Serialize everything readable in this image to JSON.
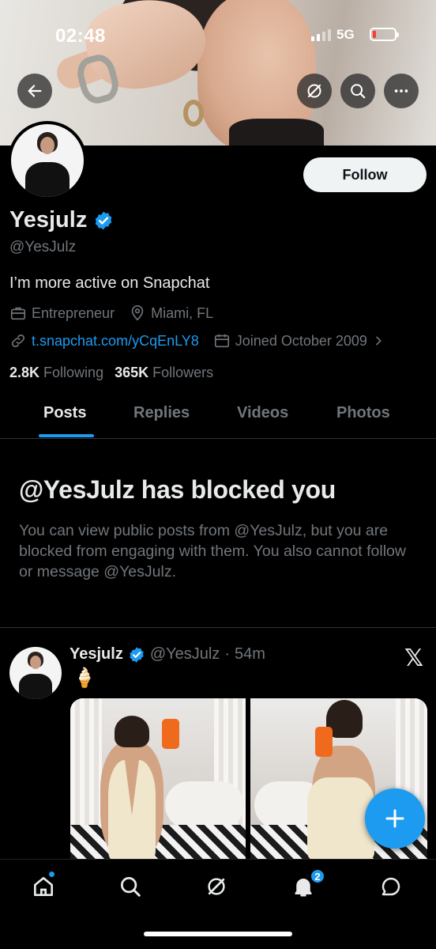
{
  "status_bar": {
    "time": "02:48",
    "network": "5G",
    "battery_color": "#ff3b30"
  },
  "header_icons": {
    "back": "back-arrow-icon",
    "grok": "grok-icon",
    "search": "search-icon",
    "more": "more-icon"
  },
  "profile": {
    "follow_label": "Follow",
    "name": "Yesjulz",
    "handle": "@YesJulz",
    "bio": "I’m more active on Snapchat",
    "category": "Entrepreneur",
    "location": "Miami, FL",
    "link": "t.snapchat.com/yCqEnLY8",
    "joined": "Joined October 2009",
    "following_count": "2.8K",
    "following_label": "Following",
    "followers_count": "365K",
    "followers_label": "Followers"
  },
  "tabs": [
    {
      "label": "Posts",
      "active": true
    },
    {
      "label": "Replies",
      "active": false
    },
    {
      "label": "Videos",
      "active": false
    },
    {
      "label": "Photos",
      "active": false
    }
  ],
  "blocked": {
    "title": "@YesJulz has blocked you",
    "body": "You can view public posts from @YesJulz, but you are blocked from engaging with them. You also cannot follow or message @YesJulz."
  },
  "post": {
    "name": "Yesjulz",
    "handle": "@YesJulz",
    "separator": "·",
    "time": "54m",
    "text": "🍦",
    "source_icon": "x-logo-icon"
  },
  "fab": {
    "icon": "plus-icon"
  },
  "bottom_nav": {
    "items": [
      "home-icon",
      "search-icon",
      "grok-icon",
      "notifications-icon",
      "messages-icon"
    ],
    "notification_count": "2"
  },
  "colors": {
    "accent": "#1d9bf0",
    "background": "#000000",
    "muted": "#71767b",
    "text": "#e7e9ea"
  }
}
